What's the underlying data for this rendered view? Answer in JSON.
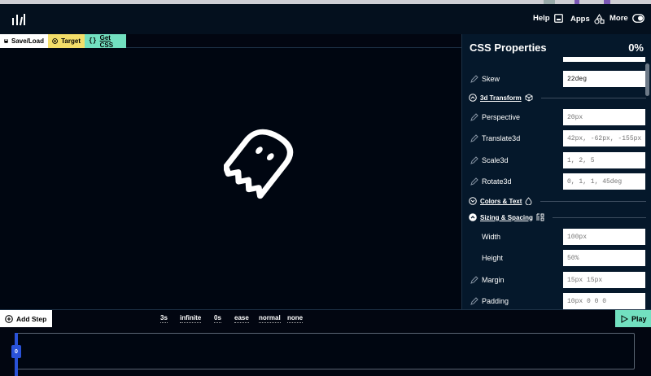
{
  "nav": {
    "help_label": "Help",
    "apps_label": "Apps",
    "more_label": "More"
  },
  "toolbar": {
    "save_label": "Save/Load",
    "target_label": "Target",
    "getcss_label": "Get CSS"
  },
  "panel": {
    "title": "CSS Properties",
    "percent": "0%",
    "skew": {
      "label": "Skew",
      "value": "22deg"
    },
    "section_3d": "3d Transform",
    "perspective": {
      "label": "Perspective",
      "placeholder": "20px"
    },
    "translate3d": {
      "label": "Translate3d",
      "placeholder": "42px, -62px, -155px"
    },
    "scale3d": {
      "label": "Scale3d",
      "placeholder": "1, 2, 5"
    },
    "rotate3d": {
      "label": "Rotate3d",
      "placeholder": "0, 1, 1, 45deg"
    },
    "section_colors": "Colors & Text",
    "section_sizing": "Sizing & Spacing",
    "width": {
      "label": "Width",
      "placeholder": "100px"
    },
    "height": {
      "label": "Height",
      "placeholder": "50%"
    },
    "margin": {
      "label": "Margin",
      "placeholder": "15px 15px"
    },
    "padding": {
      "label": "Padding",
      "placeholder": "10px 0 0 0"
    }
  },
  "bottom": {
    "add_step_label": "Add Step",
    "duration": "3s",
    "iteration": "infinite",
    "delay": "0s",
    "timing": "ease",
    "direction": "normal",
    "fill_mode": "none",
    "play_label": "Play"
  },
  "timeline": {
    "marker_label": "0"
  },
  "colors": {
    "target_yellow": "#f3de6a",
    "getcss_teal": "#72e0c0",
    "marker_blue": "#2a52d8",
    "background": "#020611",
    "panel_bg": "#05182b"
  }
}
